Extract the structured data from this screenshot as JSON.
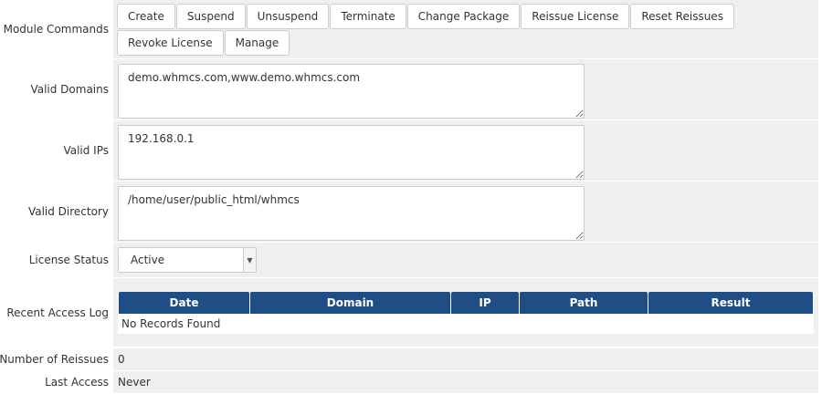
{
  "module_commands": {
    "label": "Module Commands",
    "buttons": [
      "Create",
      "Suspend",
      "Unsuspend",
      "Terminate",
      "Change Package",
      "Reissue License",
      "Reset Reissues",
      "Revoke License",
      "Manage"
    ]
  },
  "valid_domains": {
    "label": "Valid Domains",
    "value": "demo.whmcs.com,www.demo.whmcs.com"
  },
  "valid_ips": {
    "label": "Valid IPs",
    "value": "192.168.0.1"
  },
  "valid_directory": {
    "label": "Valid Directory",
    "value": "/home/user/public_html/whmcs"
  },
  "license_status": {
    "label": "License Status",
    "value": "Active"
  },
  "recent_access_log": {
    "label": "Recent Access Log",
    "columns": [
      "Date",
      "Domain",
      "IP",
      "Path",
      "Result"
    ],
    "empty_message": "No Records Found"
  },
  "number_of_reissues": {
    "label": "Number of Reissues",
    "value": "0"
  },
  "last_access": {
    "label": "Last Access",
    "value": "Never"
  },
  "colors": {
    "header_blue": "#1f4e87",
    "field_bg": "#efefef"
  },
  "icons": {
    "select_arrow": "chevron-down-icon",
    "resize_grip": "resize-grip-icon"
  }
}
